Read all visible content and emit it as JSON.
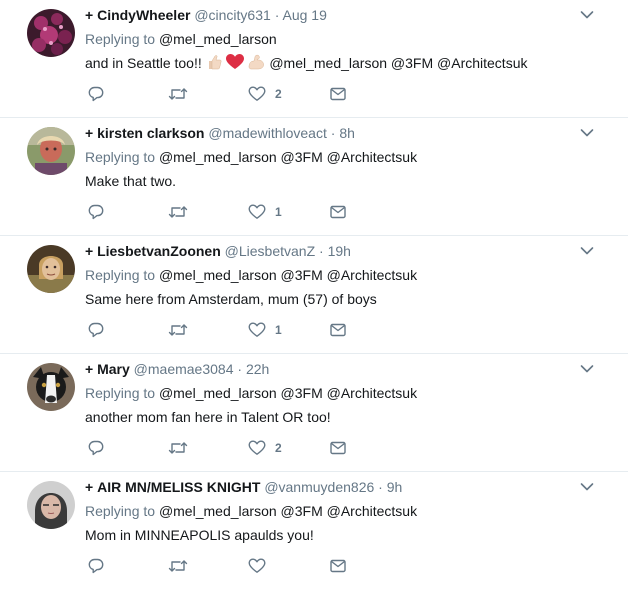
{
  "tweets": [
    {
      "plus": "+",
      "name": "CindyWheeler",
      "handle": "@cincity631",
      "dot": "·",
      "time": "Aug 19",
      "replying_label": "Replying to",
      "replying_to": "@mel_med_larson",
      "text_before": "and in Seattle too!!",
      "text_after": "@mel_med_larson @3FM @Architectsuk",
      "emojis": [
        "thumbs-up-light",
        "red-heart",
        "flexed-biceps-light"
      ],
      "like_count": "2",
      "avatar": {
        "kind": "flowers",
        "colors": [
          "#6b1f4a",
          "#a0306a",
          "#3c1a2c"
        ]
      }
    },
    {
      "plus": "+",
      "name": "kirsten clarkson",
      "handle": "@madewithloveact",
      "dot": "·",
      "time": "8h",
      "replying_label": "Replying to",
      "replying_to": "@mel_med_larson @3FM @Architectsuk",
      "text": "Make that two.",
      "like_count": "1",
      "avatar": {
        "kind": "person",
        "colors": [
          "#9a8a6a",
          "#c96b5a",
          "#6e7e58"
        ]
      }
    },
    {
      "plus": "+",
      "name": "LiesbetvanZoonen",
      "handle": "@LiesbetvanZ",
      "dot": "·",
      "time": "19h",
      "replying_label": "Replying to",
      "replying_to": "@mel_med_larson @3FM @Architectsuk",
      "text": "Same here from Amsterdam, mum (57) of boys",
      "like_count": "1",
      "avatar": {
        "kind": "person",
        "colors": [
          "#5a4a32",
          "#d8b78a",
          "#8a7a4a"
        ]
      }
    },
    {
      "plus": "+",
      "name": "Mary",
      "handle": "@maemae3084",
      "dot": "·",
      "time": "22h",
      "replying_label": "Replying to",
      "replying_to": "@mel_med_larson @3FM @Architectsuk",
      "text": "another mom fan here in Talent OR too!",
      "like_count": "2",
      "avatar": {
        "kind": "dog",
        "colors": [
          "#1a1a1a",
          "#f2f2f2",
          "#7a6a5a"
        ]
      }
    },
    {
      "plus": "+",
      "name": "AIR MN/MELISS KNIGHT",
      "handle": "@vanmuyden826",
      "dot": "·",
      "time": "9h",
      "replying_label": "Replying to",
      "replying_to": "@mel_med_larson @3FM @Architectsuk",
      "text": "Mom in MINNEAPOLIS apaulds you!",
      "like_count": "",
      "avatar": {
        "kind": "person",
        "colors": [
          "#3a3a3a",
          "#d9b8a8",
          "#cfcfcf"
        ]
      }
    }
  ],
  "icons": {
    "reply": "reply-icon",
    "retweet": "retweet-icon",
    "like": "heart-icon",
    "dm": "envelope-icon",
    "menu": "chevron-down-icon"
  },
  "colors": {
    "muted": "#657786",
    "text": "#14171a",
    "divider": "#e6ecf0",
    "heart_emoji": "#dd2e44"
  }
}
